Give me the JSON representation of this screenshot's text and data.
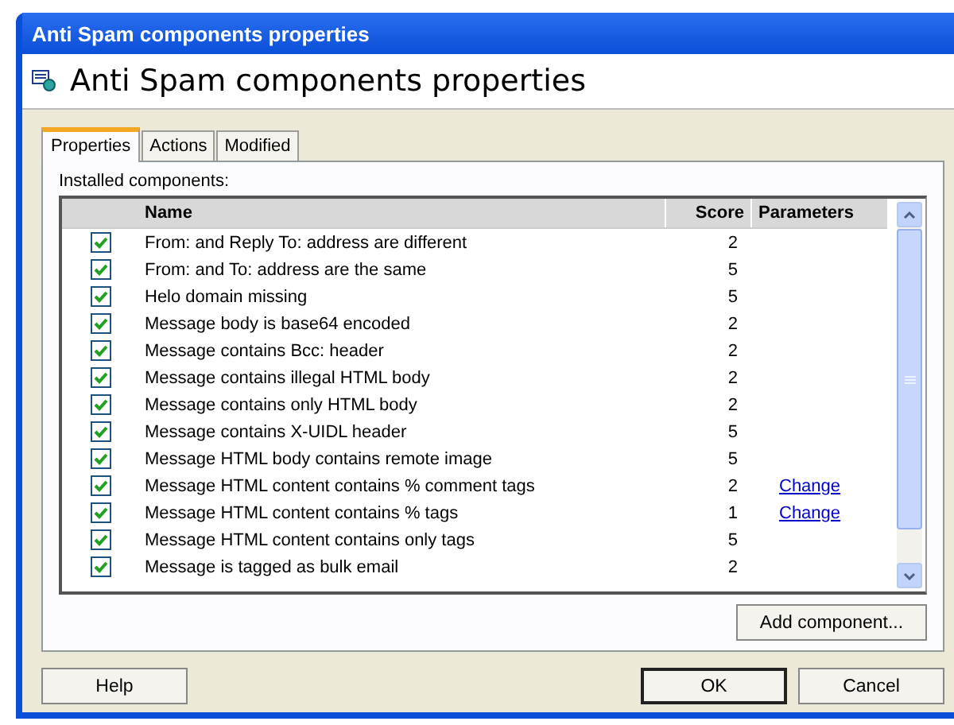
{
  "window": {
    "title": "Anti Spam components properties"
  },
  "header": {
    "title": "Anti Spam components properties"
  },
  "tabs": [
    {
      "label": "Properties",
      "selected": true
    },
    {
      "label": "Actions",
      "selected": false
    },
    {
      "label": "Modified",
      "selected": false
    }
  ],
  "list_label": "Installed components:",
  "table": {
    "columns": [
      "Name",
      "Score",
      "Parameters"
    ],
    "rows": [
      {
        "checked": true,
        "name": "From: and Reply To: address are different",
        "score": "2"
      },
      {
        "checked": true,
        "name": "From: and To: address are the same",
        "score": "5"
      },
      {
        "checked": true,
        "name": "Helo domain missing",
        "score": "5"
      },
      {
        "checked": true,
        "name": "Message body is base64 encoded",
        "score": "2"
      },
      {
        "checked": true,
        "name": "Message contains Bcc: header",
        "score": "2"
      },
      {
        "checked": true,
        "name": "Message contains illegal HTML body",
        "score": "2"
      },
      {
        "checked": true,
        "name": "Message contains only HTML body",
        "score": "2"
      },
      {
        "checked": true,
        "name": "Message contains X-UIDL header",
        "score": "5"
      },
      {
        "checked": true,
        "name": "Message HTML body contains remote image",
        "score": "5"
      },
      {
        "checked": true,
        "name": "Message HTML content contains % comment tags",
        "score": "2",
        "parameters": "Change"
      },
      {
        "checked": true,
        "name": "Message HTML content contains % tags",
        "score": "1",
        "parameters": "Change"
      },
      {
        "checked": true,
        "name": "Message HTML content contains only tags",
        "score": "5"
      },
      {
        "checked": true,
        "name": "Message is tagged as bulk email",
        "score": "2"
      }
    ]
  },
  "add_button": "Add component...",
  "buttons": {
    "help": "Help",
    "ok": "OK",
    "cancel": "Cancel"
  }
}
